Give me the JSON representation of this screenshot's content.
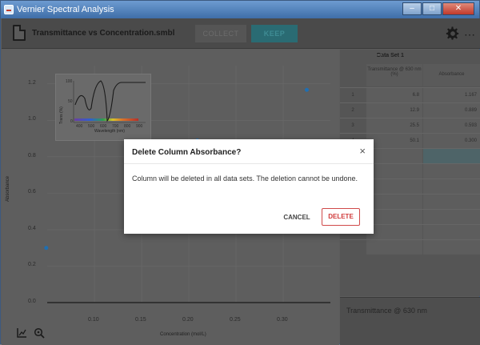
{
  "window": {
    "title": "Vernier Spectral Analysis",
    "controls": [
      "minimize",
      "maximize",
      "close"
    ]
  },
  "toolbar": {
    "file_name": "Transmittance vs Concentration.smbl",
    "collect_label": "COLLECT",
    "keep_label": "KEEP",
    "more_label": "⋯"
  },
  "graph": {
    "ylabel": "Absorbance",
    "xlabel": "Concentration (mol/L)",
    "point_color": "#1f6fb2",
    "inset": {
      "ylabel": "Trans (%)",
      "xlabel": "Wavelength (nm)",
      "yticks": [
        "100",
        "50",
        "0"
      ],
      "xticks": [
        "400",
        "500",
        "600",
        "700",
        "800",
        "900"
      ]
    }
  },
  "chart_data": {
    "type": "scatter",
    "xlabel": "Concentration (mol/L)",
    "ylabel": "Absorbance",
    "xlim": [
      0.05,
      0.35
    ],
    "ylim": [
      0.0,
      1.3
    ],
    "xticks": [
      "0.10",
      "0.15",
      "0.20",
      "0.25",
      "0.30"
    ],
    "yticks": [
      "0.0",
      "0.2",
      "0.4",
      "0.6",
      "0.8",
      "1.0",
      "1.2"
    ],
    "grid": true,
    "series": [
      {
        "x": [
          0.049,
          0.209,
          0.209,
          0.325
        ],
        "y": [
          0.3,
          0.593,
          0.889,
          1.167
        ]
      }
    ]
  },
  "table": {
    "dataset_title": "Data Set 1",
    "dash": "—",
    "columns": [
      "Transmittance @ 630 nm (%)",
      "Absorbance"
    ],
    "rows": [
      {
        "index": "1",
        "transmittance": "6.8",
        "absorbance": "1.167"
      },
      {
        "index": "2",
        "transmittance": "12.9",
        "absorbance": "0.889"
      },
      {
        "index": "3",
        "transmittance": "25.5",
        "absorbance": "0.593"
      },
      {
        "index": "4",
        "transmittance": "50.1",
        "absorbance": "0.300"
      }
    ]
  },
  "meter": {
    "label": "Transmittance @ 630 nm"
  },
  "dialog": {
    "title": "Delete Column Absorbance?",
    "close_label": "×",
    "body": "Column will be deleted in all data sets. The deletion cannot be undone.",
    "cancel_label": "CANCEL",
    "delete_label": "DELETE",
    "delete_color": "#d03a3a"
  }
}
